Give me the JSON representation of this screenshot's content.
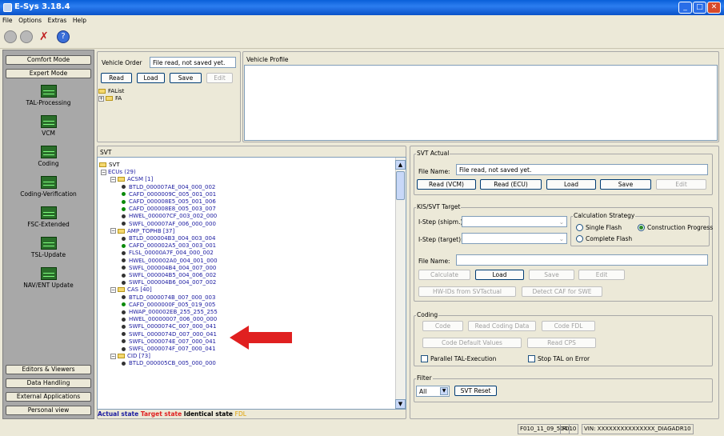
{
  "window": {
    "title": "E-Sys 3.18.4"
  },
  "menu": [
    "File",
    "Options",
    "Extras",
    "Help"
  ],
  "modes": {
    "comfort": "Comfort Mode",
    "expert": "Expert Mode"
  },
  "nav": [
    "TAL-Processing",
    "VCM",
    "Coding",
    "Coding-Verification",
    "FSC-Extended",
    "TSL-Update",
    "NAV/ENT Update"
  ],
  "bottom_buttons": [
    "Editors & Viewers",
    "Data Handling",
    "External Applications",
    "Personal view"
  ],
  "vehicle_order": {
    "label": "Vehicle Order",
    "value": "File read, not saved yet.",
    "buttons": [
      "Read",
      "Load",
      "Save",
      "Edit"
    ],
    "tree": [
      "FAList",
      "FA"
    ]
  },
  "vehicle_profile": {
    "label": "Vehicle Profile"
  },
  "svt": {
    "label": "SVT",
    "tree": [
      {
        "t": "SVT",
        "k": "root"
      },
      {
        "t": "ECUs (29)",
        "k": "n1"
      },
      {
        "t": "ACSM [1]",
        "k": "n2"
      },
      {
        "t": "BTLD_000007AE_004_000_002",
        "k": "l"
      },
      {
        "t": "CAFD_0000009C_005_001_001",
        "k": "g"
      },
      {
        "t": "CAFD_000008E5_005_001_006",
        "k": "g"
      },
      {
        "t": "CAFD_000008E8_005_003_007",
        "k": "g"
      },
      {
        "t": "HWEL_000007CF_003_002_000",
        "k": "l"
      },
      {
        "t": "SWFL_000007AF_006_000_000",
        "k": "l"
      },
      {
        "t": "AMP_TOPHB [37]",
        "k": "n2"
      },
      {
        "t": "BTLD_000004B3_004_003_004",
        "k": "l"
      },
      {
        "t": "CAFD_000002A5_003_003_001",
        "k": "g"
      },
      {
        "t": "FLSL_00000A7F_004_000_002",
        "k": "l"
      },
      {
        "t": "HWEL_000002A0_004_001_000",
        "k": "l"
      },
      {
        "t": "SWFL_000004B4_004_007_000",
        "k": "l"
      },
      {
        "t": "SWFL_000004B5_004_006_002",
        "k": "l"
      },
      {
        "t": "SWFL_000004B6_004_007_002",
        "k": "l"
      },
      {
        "t": "CAS [40]",
        "k": "n2"
      },
      {
        "t": "BTLD_0000074B_007_000_003",
        "k": "l"
      },
      {
        "t": "CAFD_0000000F_005_019_005",
        "k": "g"
      },
      {
        "t": "HWAP_000002EB_255_255_255",
        "k": "l"
      },
      {
        "t": "HWEL_00000007_006_000_000",
        "k": "l"
      },
      {
        "t": "SWFL_0000074C_007_000_041",
        "k": "l"
      },
      {
        "t": "SWFL_0000074D_007_000_041",
        "k": "l"
      },
      {
        "t": "SWFL_0000074E_007_000_041",
        "k": "l"
      },
      {
        "t": "SWFL_0000074F_007_000_041",
        "k": "l"
      },
      {
        "t": "CID [73]",
        "k": "n2"
      },
      {
        "t": "BTLD_000005CB_005_000_000",
        "k": "l"
      }
    ]
  },
  "legend": {
    "actual": "Actual state",
    "target": "Target state",
    "identical": "Identical state",
    "fdl": "FDL"
  },
  "svt_actual": {
    "label": "SVT Actual",
    "file_name_label": "File Name:",
    "file_name": "File read, not saved yet.",
    "buttons": [
      "Read (VCM)",
      "Read (ECU)",
      "Load",
      "Save",
      "Edit"
    ]
  },
  "kis": {
    "label": "KIS/SVT Target",
    "istep_shipm": "I-Step (shipm.):",
    "istep_target": "I-Step (target):",
    "strategy_label": "Calculation Strategy",
    "single": "Single Flash",
    "complete": "Complete Flash",
    "construction": "Construction Progress",
    "file_name_label": "File Name:",
    "buttons": [
      "Calculate",
      "Load",
      "Save",
      "Edit"
    ],
    "hwids": "HW-IDs from SVTactual",
    "detect": "Detect CAF for SWE"
  },
  "coding": {
    "label": "Coding",
    "buttons": [
      "Code",
      "Read Coding Data",
      "Code FDL"
    ],
    "buttons2": [
      "Code Default Values",
      "Read CPS"
    ],
    "parallel": "Parallel TAL-Execution",
    "stop": "Stop TAL on Error"
  },
  "filter": {
    "label": "Filter",
    "value": "All",
    "reset": "SVT Reset"
  },
  "status": {
    "c1": "F010_11_09_504",
    "c2": "F010",
    "c3": "VIN: XXXXXXXXXXXXXXX_DIAGADR10"
  },
  "colors": {
    "actual": "#1a1aa0",
    "target": "#e02020",
    "identical": "#000000",
    "fdl": "#e0a000",
    "arrow": "#e02020"
  }
}
